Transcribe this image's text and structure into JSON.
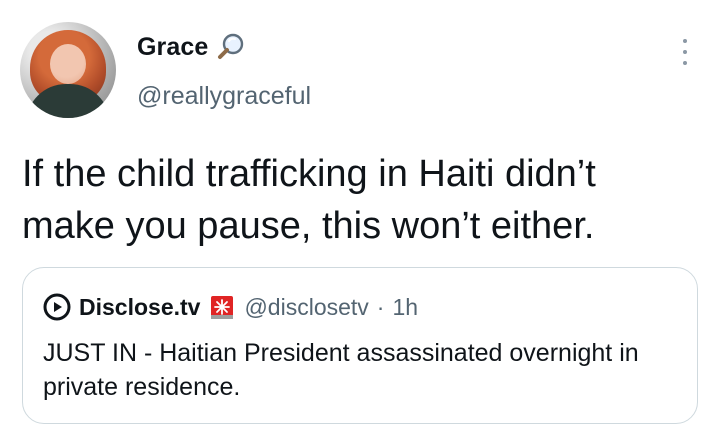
{
  "tweet": {
    "author": {
      "name": "Grace",
      "handle": "@reallygraceful",
      "name_icon": "magnifying-glass-icon"
    },
    "text": "If the child trafficking in Haiti didn’t make you pause, this won’t either.",
    "quoted": {
      "logo_icon": "play-circle-icon",
      "name": "Disclose.tv",
      "badge_icon": "siren-icon",
      "handle": "@disclosetv",
      "separator": "·",
      "time": "1h",
      "text": "JUST IN - Haitian President assassinated overnight in private residence."
    },
    "more_icon": "more-vertical-icon"
  },
  "colors": {
    "text_primary": "#0f1419",
    "text_secondary": "#536471",
    "border": "#cfd9de",
    "badge_red": "#e02424"
  }
}
